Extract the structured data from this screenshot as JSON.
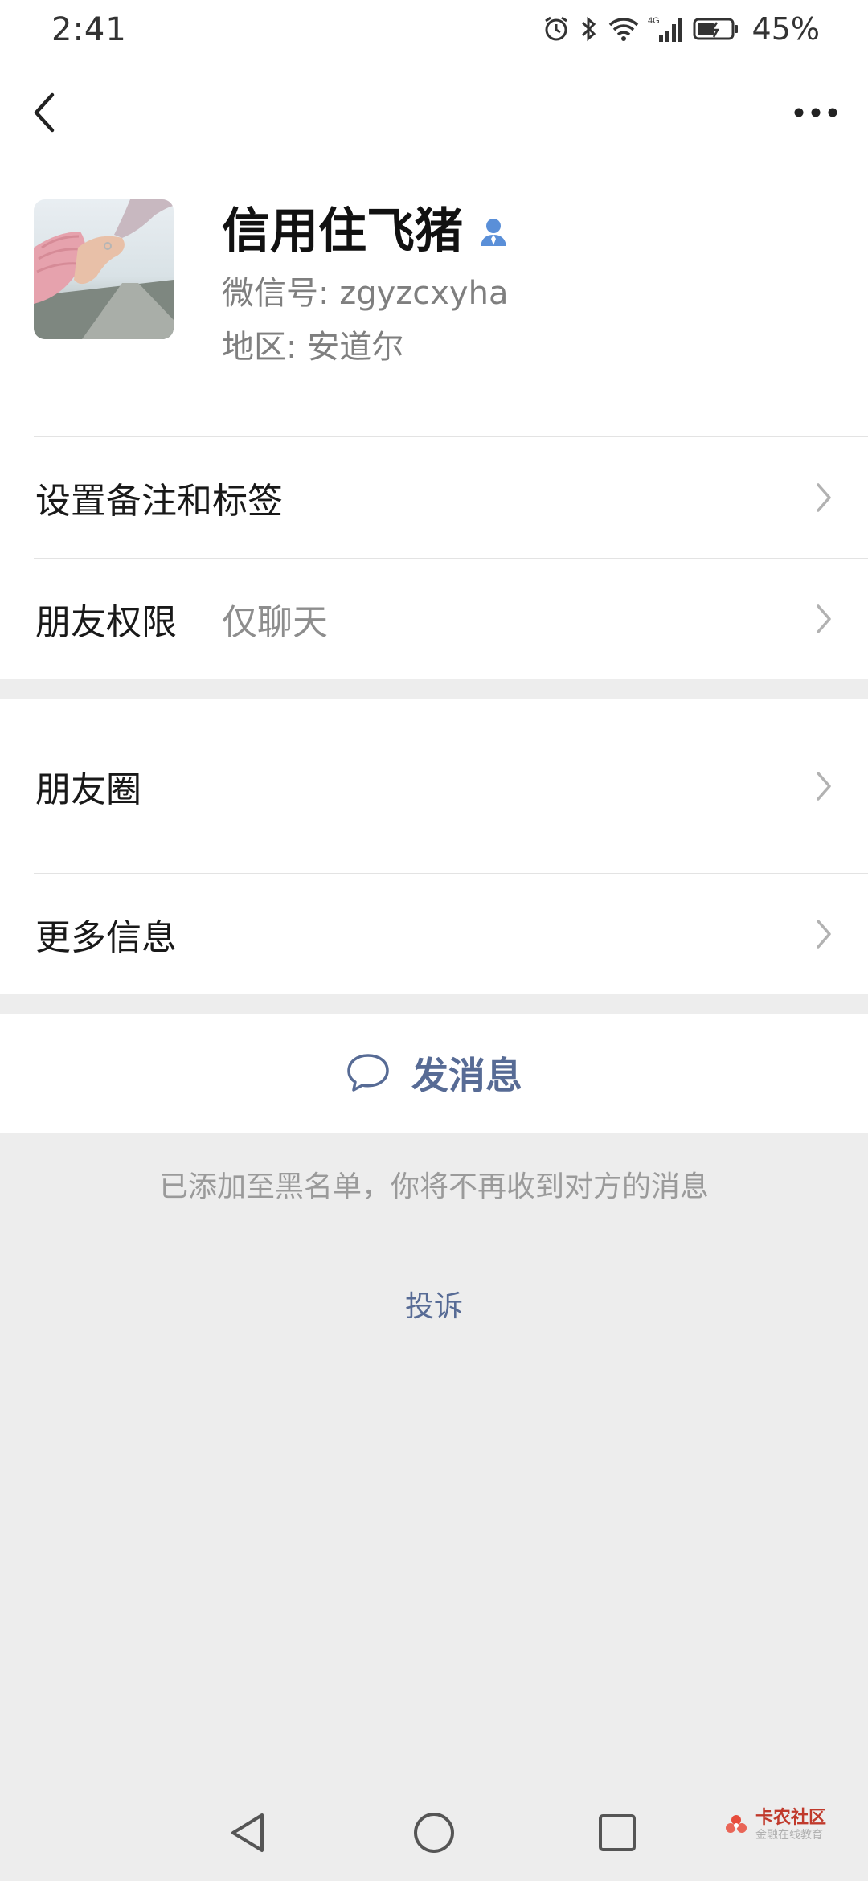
{
  "status_bar": {
    "time": "2:41",
    "network": "4G",
    "battery": "45%"
  },
  "header": {
    "back_icon": "chevron-left-icon",
    "more_icon": "more-dots-icon"
  },
  "profile": {
    "name": "信用住飞猪",
    "wechat_id_label": "微信号:",
    "wechat_id": "zgyzcxyha",
    "region_label": "地区:",
    "region": "安道尔",
    "badge_icon": "person-icon"
  },
  "menu": {
    "remark_label": "设置备注和标签",
    "permission_label": "朋友权限",
    "permission_value": "仅聊天",
    "moments_label": "朋友圈",
    "more_info_label": "更多信息"
  },
  "actions": {
    "send_message_label": "发消息",
    "send_message_icon": "chat-bubble-icon"
  },
  "notes": {
    "blacklist": "已添加至黑名单，你将不再收到对方的消息",
    "complain": "投诉"
  },
  "watermark": {
    "title": "卡农社区",
    "subtitle": "金融在线教育"
  },
  "colors": {
    "link": "#576b95",
    "background": "#ededed",
    "card": "#ffffff"
  }
}
